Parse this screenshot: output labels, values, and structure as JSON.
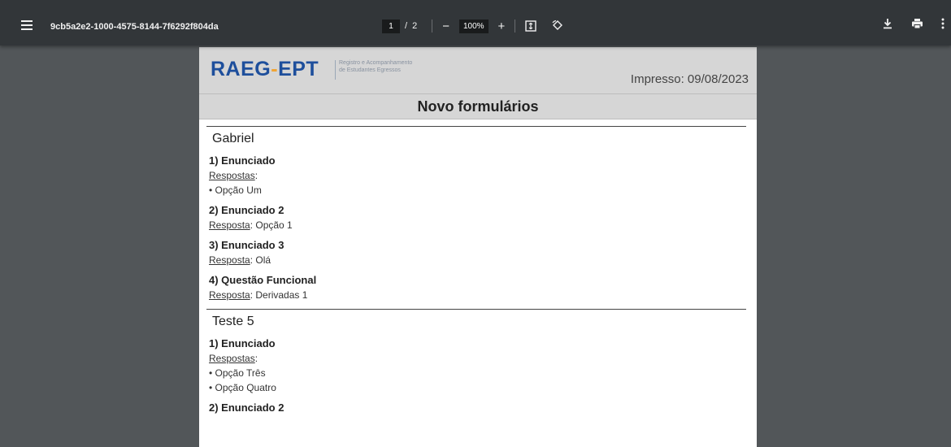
{
  "toolbar": {
    "title": "9cb5a2e2-1000-4575-8144-7f6292f804da",
    "current_page": "1",
    "page_sep": "/",
    "total_pages": "2",
    "zoom_out": "−",
    "zoom": "100%",
    "zoom_in": "+",
    "icons": [
      "menu-icon",
      "fit-page-icon",
      "rotate-icon",
      "download-icon",
      "print-icon",
      "more-icon"
    ]
  },
  "document": {
    "logo": {
      "part1": "RAEG",
      "part2": "-",
      "part3": "EPT",
      "sub1": "Registro e Acompanhamento",
      "sub2": "de Estudantes Egressos"
    },
    "printed": "Impresso: 09/08/2023",
    "title": "Novo formulários",
    "sections": [
      {
        "name": "Gabriel",
        "questions": [
          {
            "title": "1) Enunciado",
            "label": "Respostas",
            "answer": ":",
            "options": [
              "• Opção Um"
            ]
          },
          {
            "title": "2) Enunciado 2",
            "label": "Resposta",
            "answer": ": Opção 1",
            "options": []
          },
          {
            "title": "3) Enunciado 3",
            "label": "Resposta",
            "answer": ": Olá",
            "options": []
          },
          {
            "title": "4) Questão Funcional",
            "label": "Resposta",
            "answer": ": Derivadas 1",
            "options": []
          }
        ]
      },
      {
        "name": "Teste 5",
        "questions": [
          {
            "title": "1) Enunciado",
            "label": "Respostas",
            "answer": ":",
            "options": [
              "• Opção Três",
              "• Opção Quatro"
            ]
          },
          {
            "title": "2) Enunciado 2",
            "label": "",
            "answer": "",
            "options": []
          }
        ]
      }
    ]
  }
}
